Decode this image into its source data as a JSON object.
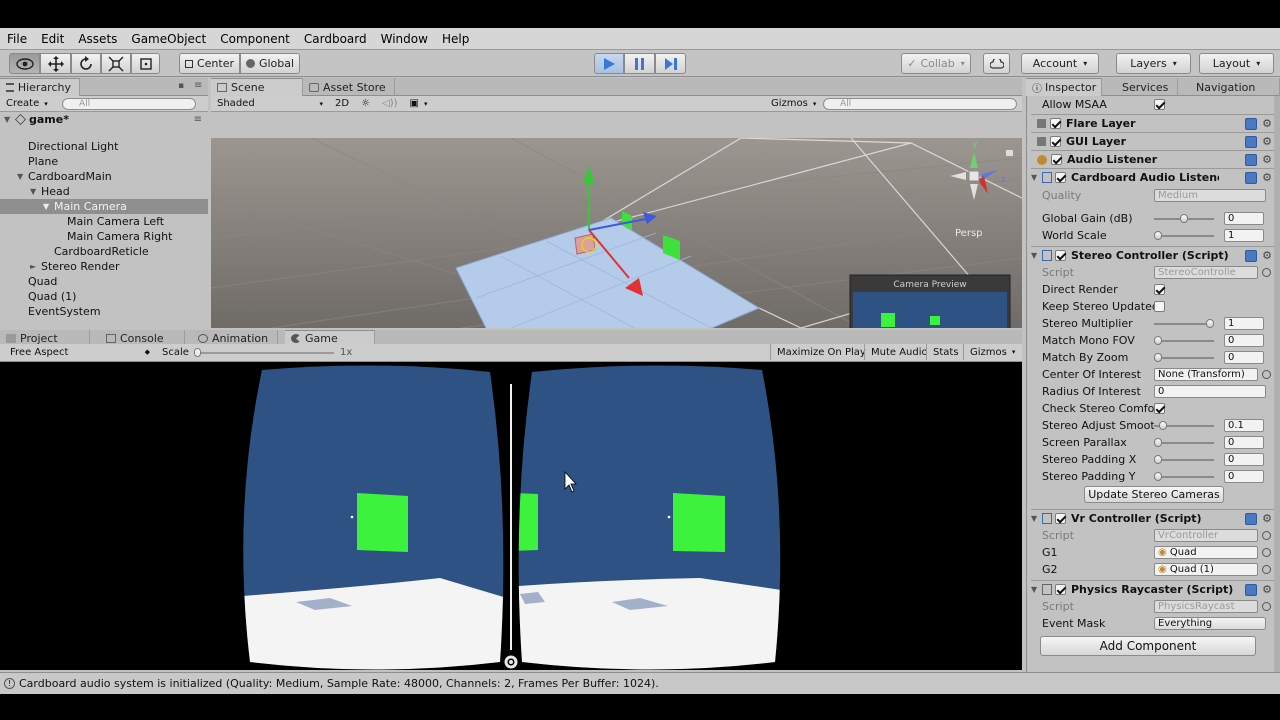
{
  "menu": [
    "File",
    "Edit",
    "Assets",
    "GameObject",
    "Component",
    "Cardboard",
    "Window",
    "Help"
  ],
  "toolbar": {
    "pivot_label": "Center",
    "space_label": "Global",
    "collab_label": "Collab",
    "account_label": "Account",
    "layers_label": "Layers",
    "layout_label": "Layout"
  },
  "hierarchy": {
    "tab": "Hierarchy",
    "create_label": "Create",
    "search_placeholder": "All",
    "scene_name": "game*",
    "items": [
      {
        "label": "Directional Light",
        "depth": 1,
        "expand": ""
      },
      {
        "label": "Plane",
        "depth": 1,
        "expand": ""
      },
      {
        "label": "CardboardMain",
        "depth": 1,
        "expand": "▼"
      },
      {
        "label": "Head",
        "depth": 2,
        "expand": "▼"
      },
      {
        "label": "Main Camera",
        "depth": 3,
        "expand": "▼",
        "selected": true
      },
      {
        "label": "Main Camera Left",
        "depth": 4,
        "expand": ""
      },
      {
        "label": "Main Camera Right",
        "depth": 4,
        "expand": ""
      },
      {
        "label": "CardboardReticle",
        "depth": 3,
        "expand": ""
      },
      {
        "label": "Stereo Render",
        "depth": 2,
        "expand": "►"
      },
      {
        "label": "Quad",
        "depth": 1,
        "expand": ""
      },
      {
        "label": "Quad (1)",
        "depth": 1,
        "expand": ""
      },
      {
        "label": "EventSystem",
        "depth": 1,
        "expand": ""
      }
    ]
  },
  "scene": {
    "tab_scene": "Scene",
    "tab_asset_store": "Asset Store",
    "shading_mode": "Shaded",
    "mode_2d": "2D",
    "gizmos_label": "Gizmos",
    "search_placeholder": "All",
    "persp_label": "Persp",
    "camera_preview_title": "Camera Preview",
    "axis_y": "y",
    "axis_z": "z"
  },
  "bottom_tabs": {
    "project": "Project",
    "console": "Console",
    "animation": "Animation",
    "game": "Game"
  },
  "game": {
    "aspect": "Free Aspect",
    "scale_label": "Scale",
    "scale_value": "1x",
    "maximize_on_play": "Maximize On Play",
    "mute_audio": "Mute Audio",
    "stats": "Stats",
    "gizmos": "Gizmos"
  },
  "status_message": "Cardboard audio system is initialized (Quality: Medium, Sample Rate: 48000, Channels: 2, Frames Per Buffer: 1024).",
  "inspector": {
    "tab_inspector": "Inspector",
    "tab_services": "Services",
    "tab_navigation": "Navigation",
    "allow_msaa_label": "Allow MSAA",
    "components_top": [
      {
        "name": "Flare Layer"
      },
      {
        "name": "GUI Layer"
      },
      {
        "name": "Audio Listener"
      }
    ],
    "cardboard_audio": {
      "name": "Cardboard Audio Listener (",
      "quality_label": "Quality",
      "quality_value": "Medium",
      "global_gain_label": "Global Gain (dB)",
      "global_gain_value": "0",
      "global_gain_fraction": 0.5,
      "world_scale_label": "World Scale",
      "world_scale_value": "1",
      "world_scale_fraction": 0.0
    },
    "stereo_controller": {
      "name": "Stereo Controller (Script)",
      "script_label": "Script",
      "script_value": "StereoControlle",
      "direct_render_label": "Direct Render",
      "keep_stereo_label": "Keep Stereo Updated",
      "stereo_multiplier_label": "Stereo Multiplier",
      "stereo_multiplier_value": "1",
      "stereo_multiplier_fraction": 1.0,
      "match_mono_fov_label": "Match Mono FOV",
      "match_mono_fov_value": "0",
      "match_by_zoom_label": "Match By Zoom",
      "match_by_zoom_value": "0",
      "center_of_interest_label": "Center Of Interest",
      "center_of_interest_value": "None (Transform)",
      "radius_of_interest_label": "Radius Of Interest",
      "radius_of_interest_value": "0",
      "check_stereo_label": "Check Stereo Comfort",
      "stereo_adjust_label": "Stereo Adjust Smooth",
      "stereo_adjust_value": "0.1",
      "stereo_adjust_fraction": 0.1,
      "screen_parallax_label": "Screen Parallax",
      "screen_parallax_value": "0",
      "stereo_padding_x_label": "Stereo Padding X",
      "stereo_padding_x_value": "0",
      "stereo_padding_y_label": "Stereo Padding Y",
      "stereo_padding_y_value": "0",
      "update_button": "Update Stereo Cameras"
    },
    "vr_controller": {
      "name": "Vr Controller (Script)",
      "script_label": "Script",
      "script_value": "VrController",
      "g1_label": "G1",
      "g1_value": "Quad",
      "g2_label": "G2",
      "g2_value": "Quad (1)"
    },
    "physics_raycaster": {
      "name": "Physics Raycaster (Script)",
      "script_label": "Script",
      "script_value": "PhysicsRaycast",
      "event_mask_label": "Event Mask",
      "event_mask_value": "Everything"
    },
    "add_component": "Add Component"
  },
  "colors": {
    "play_blue": "#3a78d8",
    "selection": "#8f8f8f",
    "game_sky": "#2e5284",
    "quad_green": "#3cf23c"
  }
}
